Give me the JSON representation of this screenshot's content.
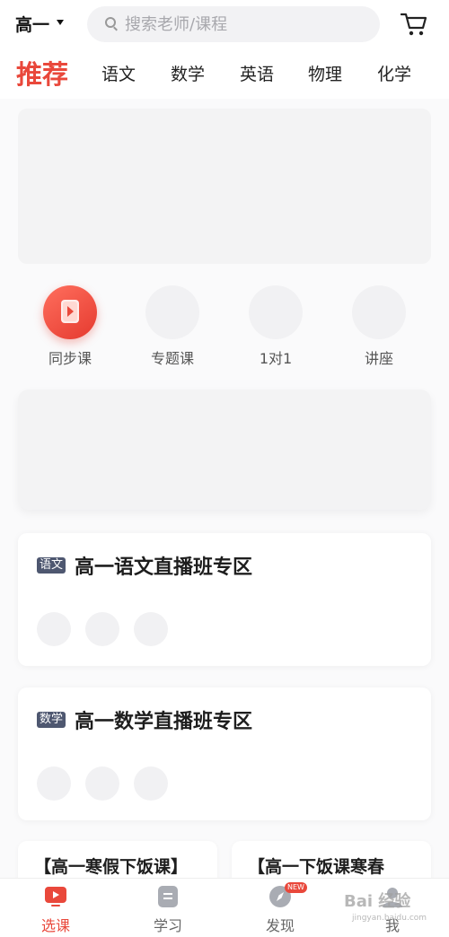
{
  "header": {
    "grade": "高一",
    "search_placeholder": "搜索老师/课程"
  },
  "tabs": [
    "推荐",
    "语文",
    "数学",
    "英语",
    "物理",
    "化学"
  ],
  "quick_entries": [
    {
      "label": "同步课",
      "icon": "play-icon"
    },
    {
      "label": "专题课",
      "icon": "placeholder-icon"
    },
    {
      "label": "1对1",
      "icon": "placeholder-icon"
    },
    {
      "label": "讲座",
      "icon": "placeholder-icon"
    }
  ],
  "zones": [
    {
      "badge": "语文",
      "title": "高一语文直播班专区"
    },
    {
      "badge": "数学",
      "title": "高一数学直播班专区"
    }
  ],
  "course_cards": [
    {
      "title": "【高一寒假下饭课】"
    },
    {
      "title": "【高一下饭课寒春"
    }
  ],
  "bottom_nav": [
    {
      "label": "选课",
      "icon": "video-icon",
      "active": true
    },
    {
      "label": "学习",
      "icon": "book-icon"
    },
    {
      "label": "发现",
      "icon": "compass-icon",
      "badge": "NEW"
    },
    {
      "label": "我",
      "icon": "user-icon"
    }
  ],
  "watermark": {
    "main": "Bai 经验",
    "sub": "jingyan.baidu.com"
  },
  "colors": {
    "accent": "#e9483b",
    "badge": "#4e5770"
  }
}
